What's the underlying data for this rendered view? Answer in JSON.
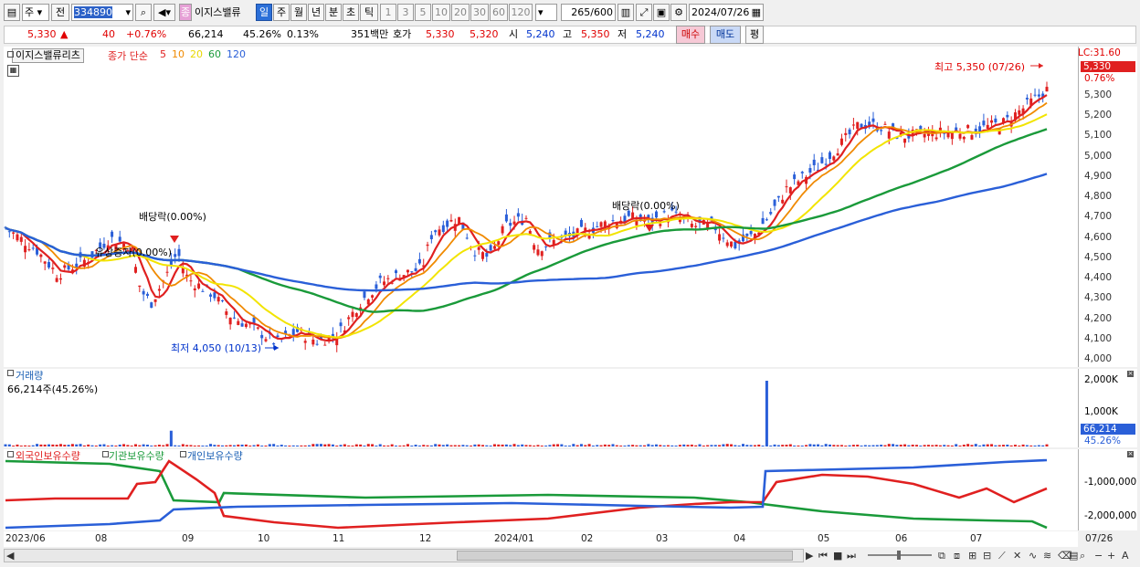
{
  "toolbar": {
    "mode": "주",
    "prev": "전",
    "code": "334890",
    "name": "이지스밸류",
    "badge": "종",
    "periods": [
      "일",
      "주",
      "월",
      "년",
      "분",
      "초",
      "틱"
    ],
    "active_period": "일",
    "minutes": [
      "1",
      "3",
      "5",
      "10",
      "20",
      "30",
      "60",
      "120"
    ],
    "count": "265",
    "count_total": "/600",
    "date": "2024/07/26"
  },
  "quote": {
    "price": "5,330",
    "arrow": "▲",
    "change": "40",
    "change_pct": "+0.76%",
    "volume": "66,214",
    "volume_pct": "45.26%",
    "turnover": "0.13%",
    "amount": "351백만",
    "ask_label": "호가",
    "ask": "5,330",
    "bid": "5,320",
    "open_label": "시",
    "open": "5,240",
    "high_label": "고",
    "high": "5,350",
    "low_label": "저",
    "low": "5,240",
    "buy": "매수",
    "sell": "매도",
    "eval": "평"
  },
  "price_panel": {
    "name_tag": "이지스밸류리츠",
    "indicator": "종가 단순",
    "ma": [
      {
        "label": "5",
        "color": "#e02020"
      },
      {
        "label": "10",
        "color": "#f08a00"
      },
      {
        "label": "20",
        "color": "#e8d800"
      },
      {
        "label": "60",
        "color": "#1a9a3a"
      },
      {
        "label": "120",
        "color": "#2a5fd8"
      }
    ],
    "lc_label": "LC:31.60",
    "last_price": "5,330",
    "last_pct": "0.76%",
    "high_note": "최고 5,350 (07/26)",
    "low_note": "최저 4,050 (10/13)",
    "div1": "배당락(0.00%)",
    "rights": "유상증자(0.00%)",
    "div2": "배당락(0.00%)",
    "yticks": [
      "5,300",
      "5,200",
      "5,100",
      "5,000",
      "4,900",
      "4,800",
      "4,700",
      "4,600",
      "4,500",
      "4,400",
      "4,300",
      "4,200",
      "4,100",
      "4,000"
    ]
  },
  "volume_panel": {
    "title": "거래량",
    "info": "66,214주(45.26%)",
    "yticks": [
      "2,000K",
      "1,000K"
    ],
    "last": "66,214",
    "last_pct": "45.26%"
  },
  "holding_panel": {
    "legend": [
      "외국인보유수량",
      "기관보유수량",
      "개인보유수량"
    ],
    "legend_colors": [
      "#e02020",
      "#1a9a3a",
      "#2a5fd8"
    ],
    "yticks": [
      "-1,000,000",
      "-2,000,000"
    ]
  },
  "xaxis": {
    "labels": [
      "2023/06",
      "08",
      "09",
      "10",
      "11",
      "12",
      "2024/01",
      "02",
      "03",
      "04",
      "05",
      "06",
      "07",
      "07/26"
    ]
  },
  "chart_data": {
    "type": "candlestick",
    "yrange": [
      4000,
      5350
    ],
    "high": {
      "value": 5350,
      "date": "07/26"
    },
    "low": {
      "value": 4050,
      "date": "10/13"
    },
    "last": 5330,
    "ma_last": {
      "5": 5270,
      "10": 5240,
      "20": 5180,
      "60": 5130,
      "120": 4910
    },
    "volume_max": 2000000,
    "last_volume": 66214
  }
}
